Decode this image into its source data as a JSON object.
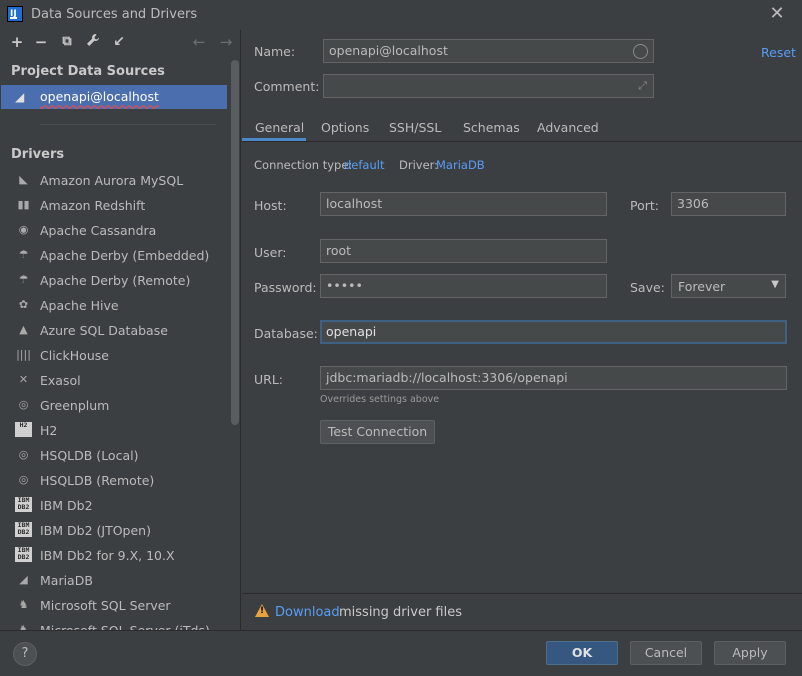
{
  "window": {
    "title": "Data Sources and Drivers",
    "app_icon": "IJ"
  },
  "toolbar": {
    "add": "+",
    "remove": "−",
    "copy": "⧉",
    "settings": "🔧",
    "import": "↙",
    "back": "←",
    "forward": "→"
  },
  "project": {
    "heading": "Project Data Sources",
    "items": [
      {
        "label": "openapi@localhost",
        "icon": "mariadb-icon"
      }
    ]
  },
  "drivers": {
    "heading": "Drivers",
    "items": [
      {
        "label": "Amazon Aurora MySQL",
        "icon": "aurora-icon",
        "glyph": "◣"
      },
      {
        "label": "Amazon Redshift",
        "icon": "redshift-icon",
        "glyph": "▮▮"
      },
      {
        "label": "Apache Cassandra",
        "icon": "cassandra-icon",
        "glyph": "◉"
      },
      {
        "label": "Apache Derby (Embedded)",
        "icon": "derby-icon",
        "glyph": "☂"
      },
      {
        "label": "Apache Derby (Remote)",
        "icon": "derby-icon",
        "glyph": "☂"
      },
      {
        "label": "Apache Hive",
        "icon": "hive-icon",
        "glyph": "✿"
      },
      {
        "label": "Azure SQL Database",
        "icon": "azure-icon",
        "glyph": "▲"
      },
      {
        "label": "ClickHouse",
        "icon": "clickhouse-icon",
        "glyph": "||||"
      },
      {
        "label": "Exasol",
        "icon": "exasol-icon",
        "glyph": "✕"
      },
      {
        "label": "Greenplum",
        "icon": "greenplum-icon",
        "glyph": "◎"
      },
      {
        "label": "H2",
        "icon": "h2-icon",
        "glyph": "H2",
        "box": true
      },
      {
        "label": "HSQLDB (Local)",
        "icon": "hsqldb-icon",
        "glyph": "◎"
      },
      {
        "label": "HSQLDB (Remote)",
        "icon": "hsqldb-icon",
        "glyph": "◎"
      },
      {
        "label": "IBM Db2",
        "icon": "ibm-db2-icon",
        "glyph": "IBM DB2",
        "box": true
      },
      {
        "label": "IBM Db2 (JTOpen)",
        "icon": "ibm-db2-icon",
        "glyph": "IBM DB2",
        "box": true
      },
      {
        "label": "IBM Db2 for 9.X, 10.X",
        "icon": "ibm-db2-icon",
        "glyph": "IBM DB2",
        "box": true
      },
      {
        "label": "MariaDB",
        "icon": "mariadb-icon",
        "glyph": "◢"
      },
      {
        "label": "Microsoft SQL Server",
        "icon": "sqlserver-icon",
        "glyph": "♞"
      },
      {
        "label": "Microsoft SQL Server (jTds)",
        "icon": "sqlserver-icon",
        "glyph": "♞"
      }
    ]
  },
  "form": {
    "name_label": "Name:",
    "name_value": "openapi@localhost",
    "reset": "Reset",
    "comment_label": "Comment:",
    "comment_value": "",
    "tabs": [
      "General",
      "Options",
      "SSH/SSL",
      "Schemas",
      "Advanced"
    ],
    "connection_type_label": "Connection type:",
    "connection_type_value": "default",
    "driver_label": "Driver:",
    "driver_value": "MariaDB",
    "host_label": "Host:",
    "host_value": "localhost",
    "port_label": "Port:",
    "port_value": "3306",
    "user_label": "User:",
    "user_value": "root",
    "password_label": "Password:",
    "password_value": "•••••",
    "save_label": "Save:",
    "save_value": "Forever",
    "database_label": "Database:",
    "database_value": "openapi",
    "url_label": "URL:",
    "url_value": "jdbc:mariadb://localhost:3306/openapi",
    "url_hint": "Overrides settings above",
    "test_button": "Test Connection"
  },
  "warning": {
    "link": "Download",
    "text": " missing driver files"
  },
  "footer": {
    "help": "?",
    "ok": "OK",
    "cancel": "Cancel",
    "apply": "Apply"
  },
  "colors": {
    "accent": "#4b6eaf",
    "link": "#589df6",
    "warning": "#e8a33d",
    "background": "#3c3f41"
  }
}
